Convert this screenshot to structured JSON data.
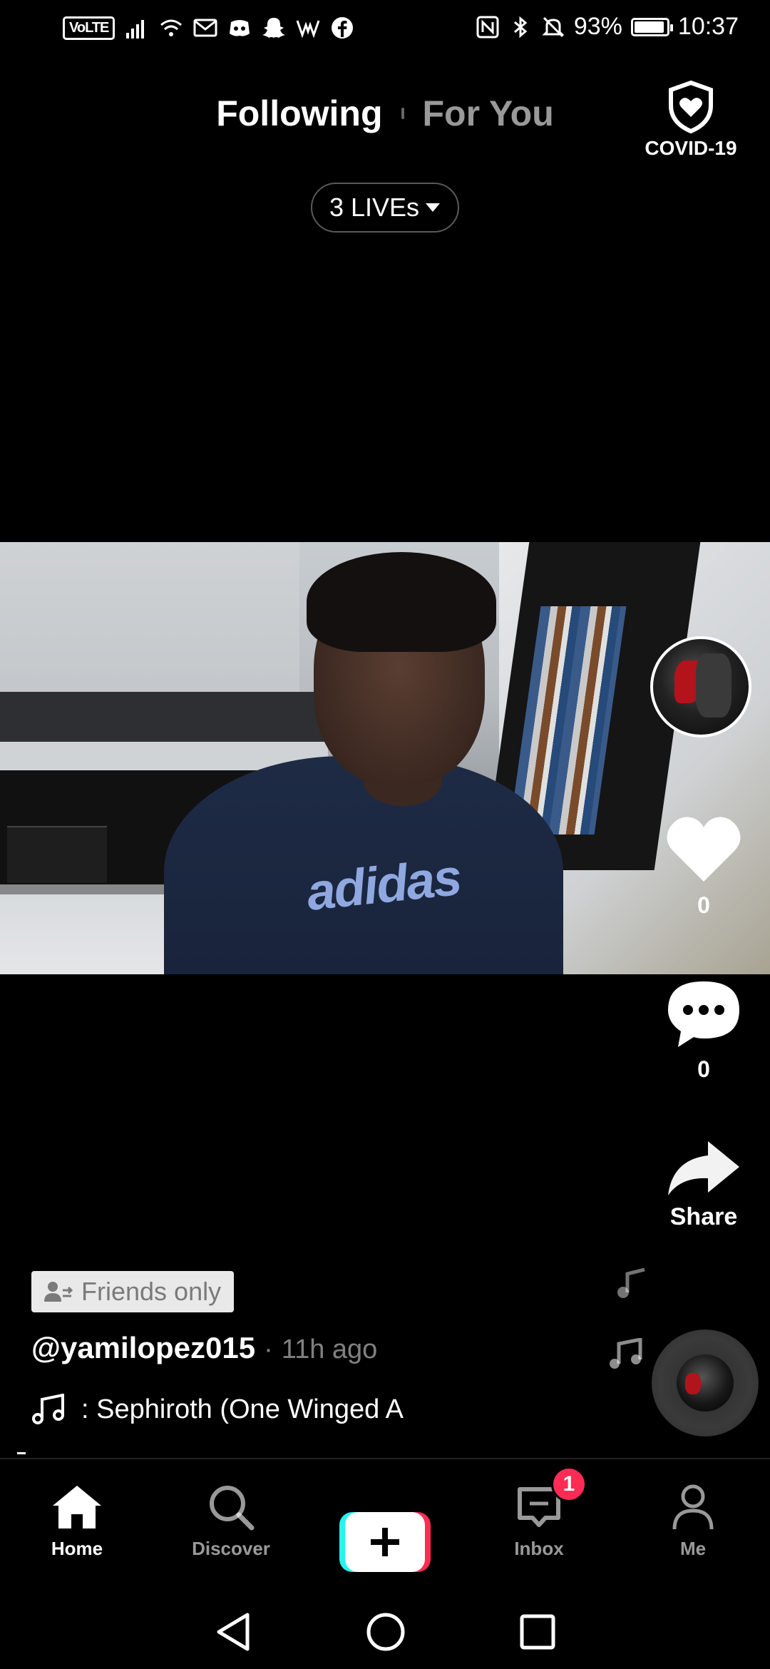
{
  "status_bar": {
    "volte": "VoLTE",
    "battery_percent": "93%",
    "battery_level": 0.93,
    "time": "10:37",
    "left_icons": [
      "signal-icon",
      "wifi-icon",
      "gmail-icon",
      "discord-icon",
      "snapchat-icon",
      "wwe-icon",
      "facebook-icon"
    ],
    "right_icons": [
      "nfc-icon",
      "bluetooth-icon",
      "mute-icon"
    ]
  },
  "top_tabs": {
    "following": "Following",
    "for_you": "For You"
  },
  "covid": {
    "label": "COVID-19"
  },
  "lives": {
    "label": "3 LIVEs"
  },
  "video": {
    "shirt_text": "adidas"
  },
  "actions": {
    "like_count": "0",
    "comment_count": "0",
    "share_label": "Share"
  },
  "post": {
    "privacy": "Friends only",
    "username": "@yamilopez015",
    "separator": "·",
    "time_ago": "11h ago",
    "sound": ": Sephiroth (One Winged A"
  },
  "nav": {
    "home": "Home",
    "discover": "Discover",
    "inbox": "Inbox",
    "inbox_badge": "1",
    "me": "Me"
  },
  "colors": {
    "accent_pink": "#fe2c55",
    "accent_cyan": "#25f4ee",
    "background": "#000000"
  }
}
